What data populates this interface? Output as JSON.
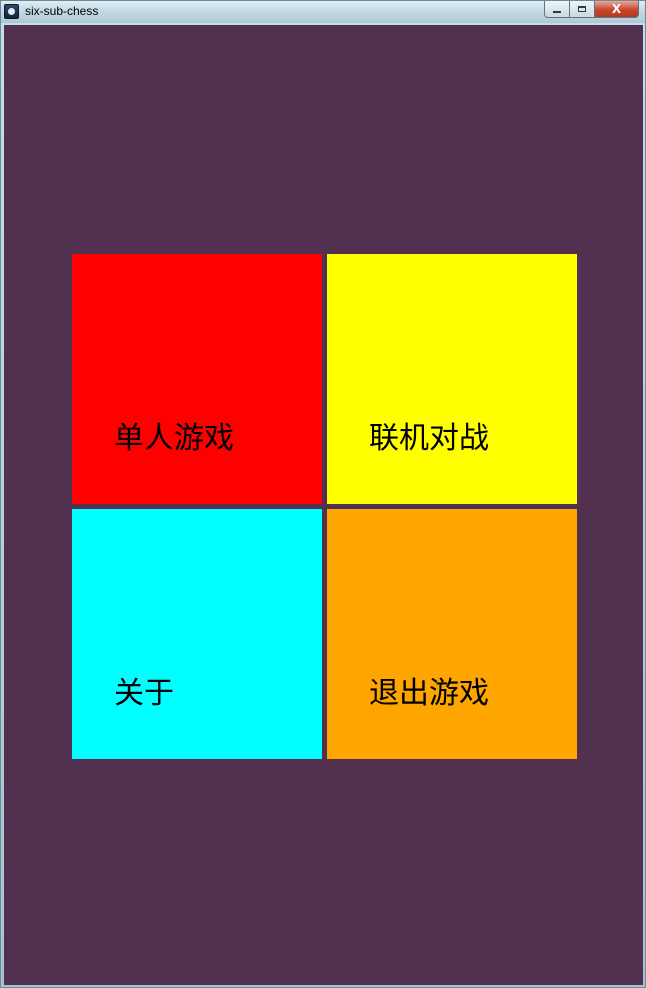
{
  "window": {
    "title": "six-sub-chess",
    "icon": "app-icon",
    "controls": {
      "minimize": "minimize-icon",
      "maximize": "maximize-icon",
      "close_label": "X"
    }
  },
  "menu": {
    "background": "#523050",
    "tiles": [
      {
        "label": "单人游戏",
        "color": "#FF0000"
      },
      {
        "label": "联机对战",
        "color": "#FFFF00"
      },
      {
        "label": "关于",
        "color": "#00FFFF"
      },
      {
        "label": "退出游戏",
        "color": "#FFA500"
      }
    ]
  }
}
